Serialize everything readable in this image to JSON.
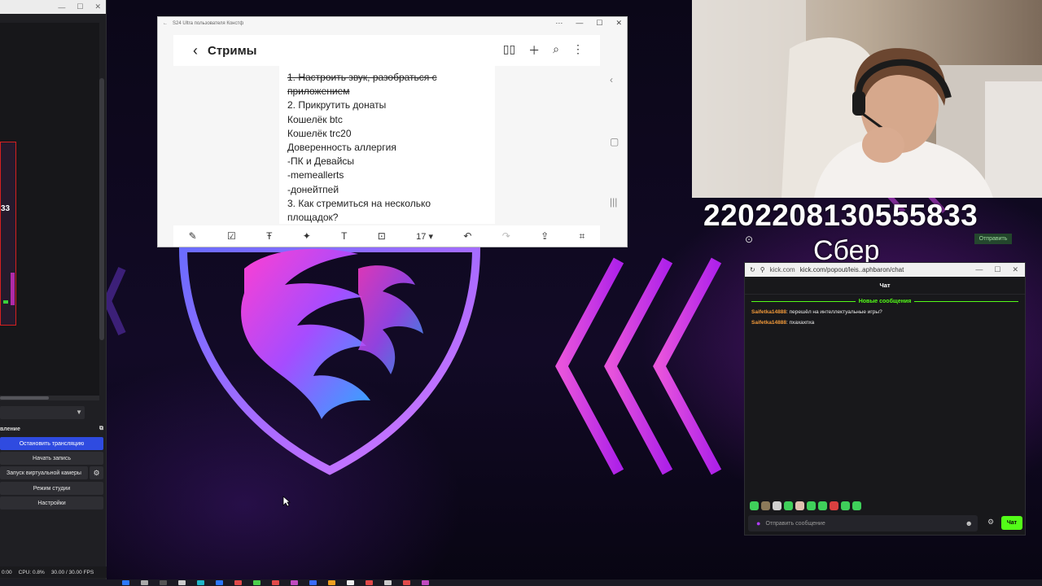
{
  "obs": {
    "controls_header": "вление",
    "buttons": {
      "stop_stream": "Остановить трансляцию",
      "start_record": "Начать запись",
      "virtual_cam": "Запуск виртуальной камеры",
      "studio_mode": "Режим студии",
      "settings": "Настройки"
    },
    "preview_number": "33",
    "status": {
      "time": "0:00",
      "cpu": "CPU: 0.8%",
      "fps": "30.00 / 30.00 FPS"
    }
  },
  "notes": {
    "window_title": "S24 Ultra пользователя Констф",
    "title": "Стримы",
    "lines": [
      {
        "text": "1. Настроить звук, разобраться с",
        "strike": true
      },
      {
        "text": "приложением",
        "strike": true
      },
      {
        "text": "2. Прикрутить донаты",
        "strike": false
      },
      {
        "text": "Кошелёк btc",
        "strike": false
      },
      {
        "text": "Кошелёк trc20",
        "strike": false
      },
      {
        "text": "Доверенность аллергия",
        "strike": false
      },
      {
        "text": "-ПК и Девайсы",
        "strike": false
      },
      {
        "text": "-memeallerts",
        "strike": false
      },
      {
        "text": "-донейтпей",
        "strike": false
      },
      {
        "text": "3. Как стремиться на несколько",
        "strike": false
      },
      {
        "text": "площадок?",
        "strike": false
      }
    ],
    "font_size_value": "17"
  },
  "overlay": {
    "card_number": "2202208130555833",
    "bank": "Сбер",
    "send_label": "Отправить"
  },
  "chat": {
    "url_site": "kick.com",
    "url_path": "kick.com/popout/leis..aphbaron/chat",
    "title": "Чат",
    "new_messages_label": "Новые сообщения",
    "messages": [
      {
        "user": "Saifetka14888",
        "text": ": перешёл на интеллектуальные игры?"
      },
      {
        "user": "Saifetka14888",
        "text": ": пхахахпха"
      }
    ],
    "input_placeholder": "Отправить сообщение",
    "send_label": "Чат"
  },
  "colors": {
    "kick_green": "#53fc18",
    "obs_active": "#2f4be0",
    "username": "#f29a3a"
  }
}
